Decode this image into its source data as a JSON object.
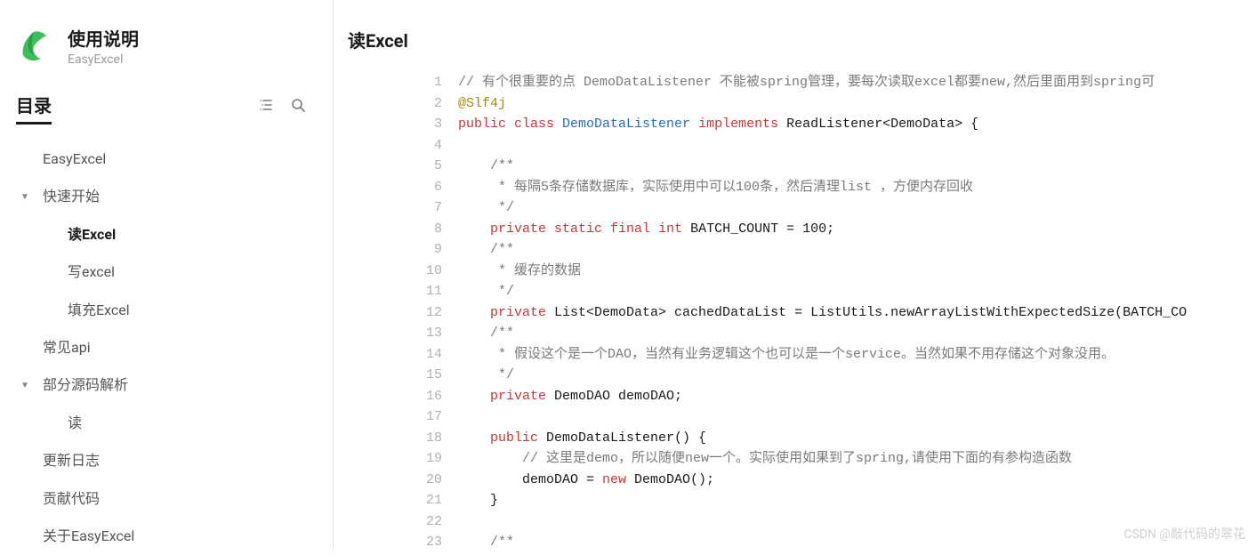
{
  "brand": {
    "title": "使用说明",
    "subtitle": "EasyExcel"
  },
  "toc": {
    "label": "目录"
  },
  "nav": [
    {
      "label": "EasyExcel",
      "level": 0,
      "caret": false,
      "active": false
    },
    {
      "label": "快速开始",
      "level": 0,
      "caret": true,
      "active": false
    },
    {
      "label": "读Excel",
      "level": 1,
      "caret": false,
      "active": true
    },
    {
      "label": "写excel",
      "level": 1,
      "caret": false,
      "active": false
    },
    {
      "label": "填充Excel",
      "level": 1,
      "caret": false,
      "active": false
    },
    {
      "label": "常见api",
      "level": 0,
      "caret": false,
      "active": false
    },
    {
      "label": "部分源码解析",
      "level": 0,
      "caret": true,
      "active": false
    },
    {
      "label": "读",
      "level": 1,
      "caret": false,
      "active": false
    },
    {
      "label": "更新日志",
      "level": 0,
      "caret": false,
      "active": false
    },
    {
      "label": "贡献代码",
      "level": 0,
      "caret": false,
      "active": false
    },
    {
      "label": "关于EasyExcel",
      "level": 0,
      "caret": false,
      "active": false
    }
  ],
  "page": {
    "title": "读Excel"
  },
  "code": {
    "start_line": 1,
    "lines": [
      [
        [
          "com",
          "// 有个很重要的点 DemoDataListener 不能被spring管理，要每次读取excel都要new,然后里面用到spring可"
        ]
      ],
      [
        [
          "ann",
          "@Slf4j"
        ]
      ],
      [
        [
          "kw",
          "public "
        ],
        [
          "kw",
          "class "
        ],
        [
          "type",
          "DemoDataListener "
        ],
        [
          "kw",
          "implements "
        ],
        [
          "pl",
          "ReadListener<DemoData> {"
        ]
      ],
      [
        [
          "pl",
          ""
        ]
      ],
      [
        [
          "pl",
          "    "
        ],
        [
          "com",
          "/**"
        ]
      ],
      [
        [
          "pl",
          "    "
        ],
        [
          "com",
          " * 每隔5条存储数据库，实际使用中可以100条，然后清理list ，方便内存回收"
        ]
      ],
      [
        [
          "pl",
          "    "
        ],
        [
          "com",
          " */"
        ]
      ],
      [
        [
          "pl",
          "    "
        ],
        [
          "kw",
          "private "
        ],
        [
          "kw",
          "static "
        ],
        [
          "kw",
          "final "
        ],
        [
          "kw",
          "int "
        ],
        [
          "pl",
          "BATCH_COUNT = "
        ],
        [
          "num",
          "100"
        ],
        [
          "pl",
          ";"
        ]
      ],
      [
        [
          "pl",
          "    "
        ],
        [
          "com",
          "/**"
        ]
      ],
      [
        [
          "pl",
          "    "
        ],
        [
          "com",
          " * 缓存的数据"
        ]
      ],
      [
        [
          "pl",
          "    "
        ],
        [
          "com",
          " */"
        ]
      ],
      [
        [
          "pl",
          "    "
        ],
        [
          "kw",
          "private "
        ],
        [
          "pl",
          "List<DemoData> cachedDataList = ListUtils.newArrayListWithExpectedSize(BATCH_CO"
        ]
      ],
      [
        [
          "pl",
          "    "
        ],
        [
          "com",
          "/**"
        ]
      ],
      [
        [
          "pl",
          "    "
        ],
        [
          "com",
          " * 假设这个是一个DAO，当然有业务逻辑这个也可以是一个service。当然如果不用存储这个对象没用。"
        ]
      ],
      [
        [
          "pl",
          "    "
        ],
        [
          "com",
          " */"
        ]
      ],
      [
        [
          "pl",
          "    "
        ],
        [
          "kw",
          "private "
        ],
        [
          "pl",
          "DemoDAO demoDAO;"
        ]
      ],
      [
        [
          "pl",
          ""
        ]
      ],
      [
        [
          "pl",
          "    "
        ],
        [
          "kw",
          "public "
        ],
        [
          "pl",
          "DemoDataListener() {"
        ]
      ],
      [
        [
          "pl",
          "        "
        ],
        [
          "com",
          "// 这里是demo，所以随便new一个。实际使用如果到了spring,请使用下面的有参构造函数"
        ]
      ],
      [
        [
          "pl",
          "        demoDAO = "
        ],
        [
          "kw",
          "new "
        ],
        [
          "pl",
          "DemoDAO();"
        ]
      ],
      [
        [
          "pl",
          "    }"
        ]
      ],
      [
        [
          "pl",
          ""
        ]
      ],
      [
        [
          "pl",
          "    "
        ],
        [
          "com",
          "/**"
        ]
      ]
    ]
  },
  "watermark": "CSDN @敲代码的翠花"
}
